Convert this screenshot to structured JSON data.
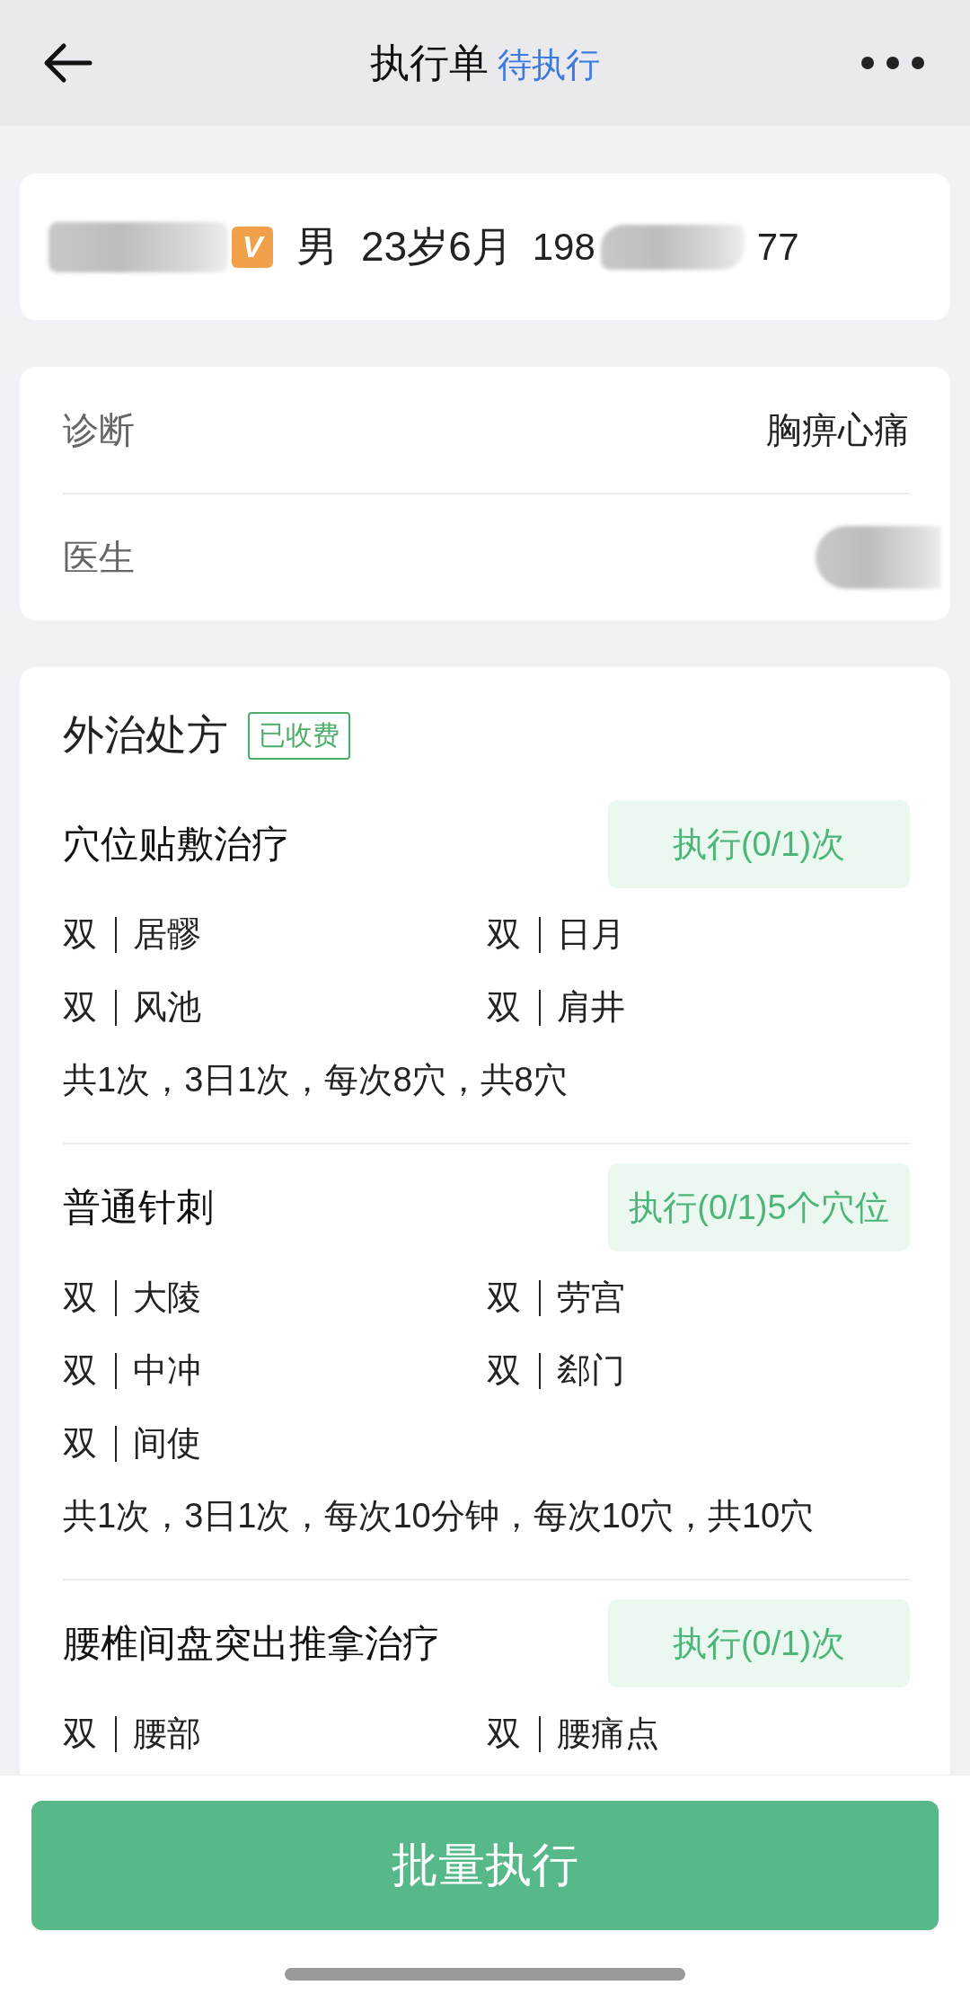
{
  "header": {
    "title": "执行单",
    "status": "待执行"
  },
  "patient": {
    "name_redacted": true,
    "vip_badge": "V",
    "gender": "男",
    "age": "23岁6月",
    "phone_start": "198",
    "phone_end": "77"
  },
  "info_rows": [
    {
      "label": "诊断",
      "value": "胸痹心痛",
      "redacted": false
    },
    {
      "label": "医生",
      "redacted": true
    }
  ],
  "prescription": {
    "title": "外治处方",
    "tag": "已收费",
    "items": [
      {
        "name": "穴位贴敷治疗",
        "action": "执行(0/1)次",
        "points": [
          {
            "side": "双",
            "name": "居髎"
          },
          {
            "side": "双",
            "name": "日月"
          },
          {
            "side": "双",
            "name": "风池"
          },
          {
            "side": "双",
            "name": "肩井"
          }
        ],
        "summary": "共1次，3日1次，每次8穴，共8穴"
      },
      {
        "name": "普通针刺",
        "action": "执行(0/1)5个穴位",
        "points": [
          {
            "side": "双",
            "name": "大陵"
          },
          {
            "side": "双",
            "name": "劳宫"
          },
          {
            "side": "双",
            "name": "中冲"
          },
          {
            "side": "双",
            "name": "郄门"
          },
          {
            "side": "双",
            "name": "间使"
          }
        ],
        "summary": "共1次，3日1次，每次10分钟，每次10穴，共10穴"
      },
      {
        "name": "腰椎间盘突出推拿治疗",
        "action": "执行(0/1)次",
        "points": [
          {
            "side": "双",
            "name": "腰部"
          },
          {
            "side": "双",
            "name": "腰痛点"
          }
        ]
      }
    ]
  },
  "footer_button": "批量执行"
}
